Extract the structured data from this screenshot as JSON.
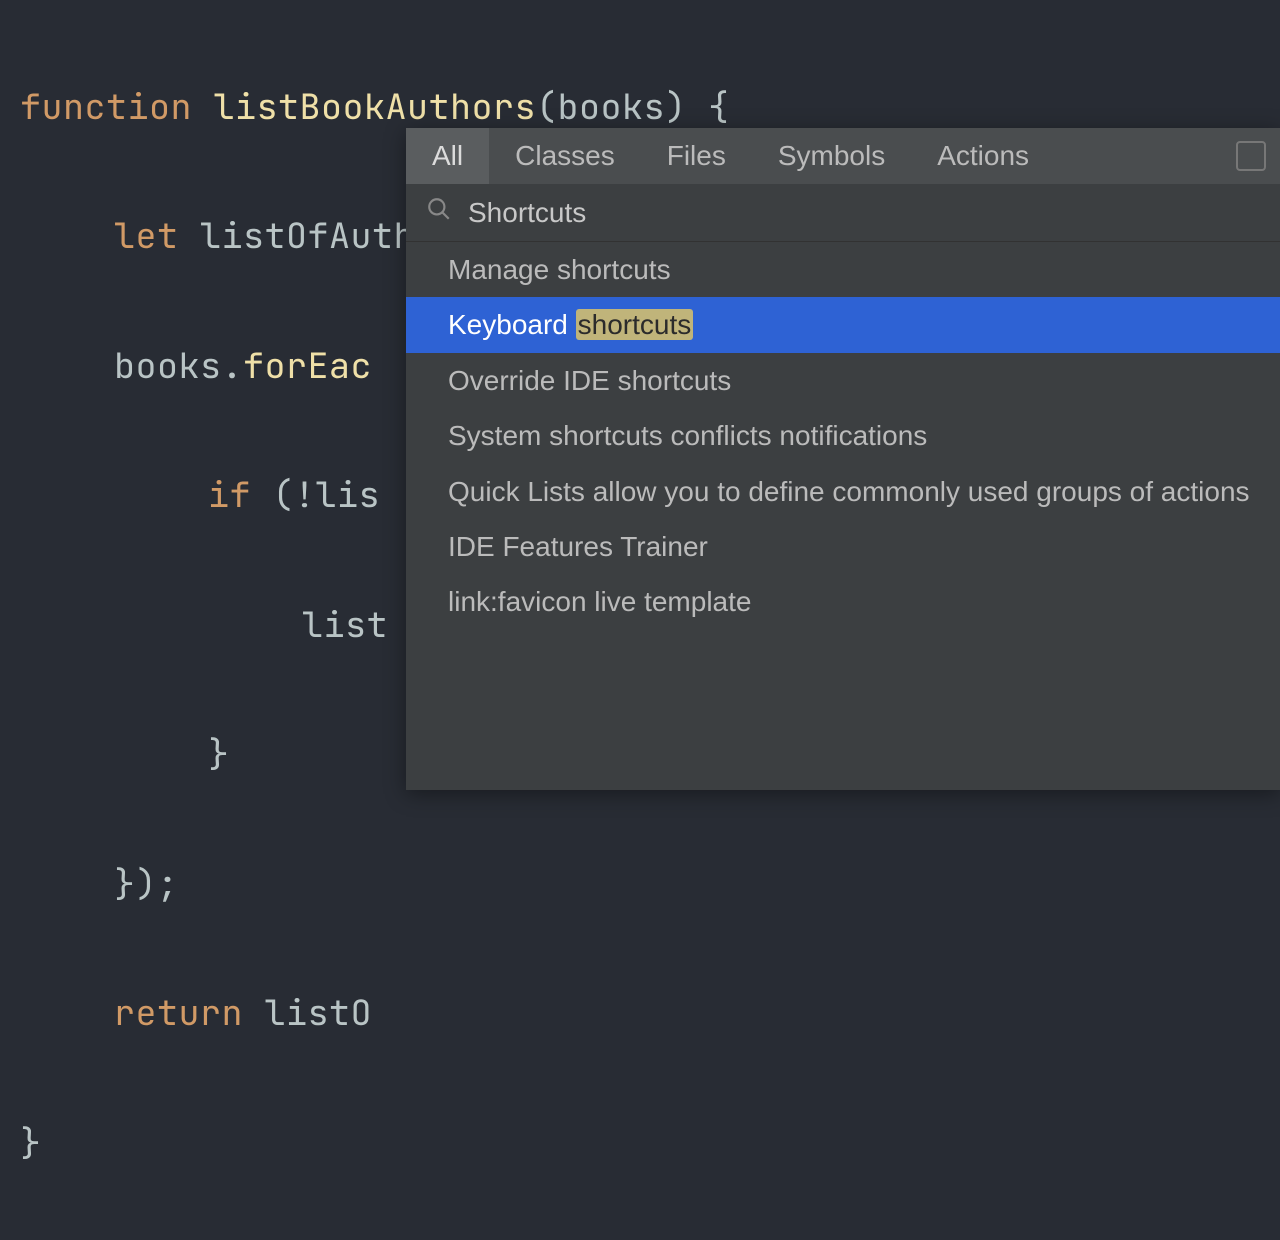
{
  "code": {
    "l1_kw": "function",
    "l1_fn": "listBookAuthors",
    "l1_rest": "(books) {",
    "l2_kw": "let",
    "l2_rest": " listOfAuthors = [];",
    "l3_a": "books.",
    "l3_fn": "forEac",
    "l4_kw": "if",
    "l4_rest": " (!lis",
    "l5": "list",
    "l6": "}",
    "l7": "});",
    "l8_kw": "return",
    "l8_rest": " listO",
    "l9": "}"
  },
  "popup": {
    "tabs": [
      "All",
      "Classes",
      "Files",
      "Symbols",
      "Actions"
    ],
    "active_tab_index": 0,
    "search_value": "Shortcuts",
    "results": [
      {
        "text": "Manage shortcuts",
        "selected": false
      },
      {
        "prefix": "Keyboard ",
        "highlight": "shortcuts",
        "selected": true
      },
      {
        "text": "Override IDE shortcuts",
        "selected": false
      },
      {
        "text": "System shortcuts conflicts notifications",
        "selected": false
      },
      {
        "text": "Quick Lists allow you to define commonly used groups of actions",
        "selected": false
      },
      {
        "text": "IDE Features Trainer",
        "selected": false
      },
      {
        "text": "link:favicon live template",
        "selected": false
      }
    ]
  }
}
